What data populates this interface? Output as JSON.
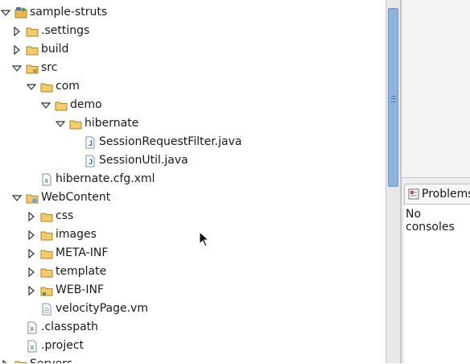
{
  "tree": {
    "rows": [
      {
        "label": "sample-struts",
        "expanded": true,
        "icon": "project-icon"
      },
      {
        "label": ".settings",
        "expanded": false,
        "icon": "folder-icon"
      },
      {
        "label": "build",
        "expanded": false,
        "icon": "folder-icon"
      },
      {
        "label": "src",
        "expanded": true,
        "icon": "source-folder-icon"
      },
      {
        "label": "com",
        "expanded": true,
        "icon": "package-folder-icon"
      },
      {
        "label": "demo",
        "expanded": true,
        "icon": "package-folder-icon"
      },
      {
        "label": "hibernate",
        "expanded": true,
        "icon": "package-folder-icon"
      },
      {
        "label": "SessionRequestFilter.java",
        "icon": "java-file-icon"
      },
      {
        "label": "SessionUtil.java",
        "icon": "java-file-icon"
      },
      {
        "label": "hibernate.cfg.xml",
        "icon": "xml-file-icon"
      },
      {
        "label": "WebContent",
        "expanded": true,
        "icon": "web-folder-icon"
      },
      {
        "label": "css",
        "expanded": false,
        "icon": "folder-icon"
      },
      {
        "label": "images",
        "expanded": false,
        "icon": "folder-icon"
      },
      {
        "label": "META-INF",
        "expanded": false,
        "icon": "folder-icon"
      },
      {
        "label": "template",
        "expanded": false,
        "icon": "folder-icon"
      },
      {
        "label": "WEB-INF",
        "expanded": false,
        "icon": "web-inf-folder-icon"
      },
      {
        "label": "velocityPage.vm",
        "icon": "text-file-icon"
      },
      {
        "label": ".classpath",
        "icon": "xml-file-icon"
      },
      {
        "label": ".project",
        "icon": "xml-file-icon"
      },
      {
        "label": "Servers",
        "expanded": false,
        "icon": "folder-icon"
      }
    ]
  },
  "right_panel": {
    "tab_label": "Problems",
    "console_message": "No consoles"
  },
  "colors": {
    "folder": "#e8b84a",
    "scroll_thumb": "#8fb3df",
    "java_icon": "#2a63b8"
  }
}
